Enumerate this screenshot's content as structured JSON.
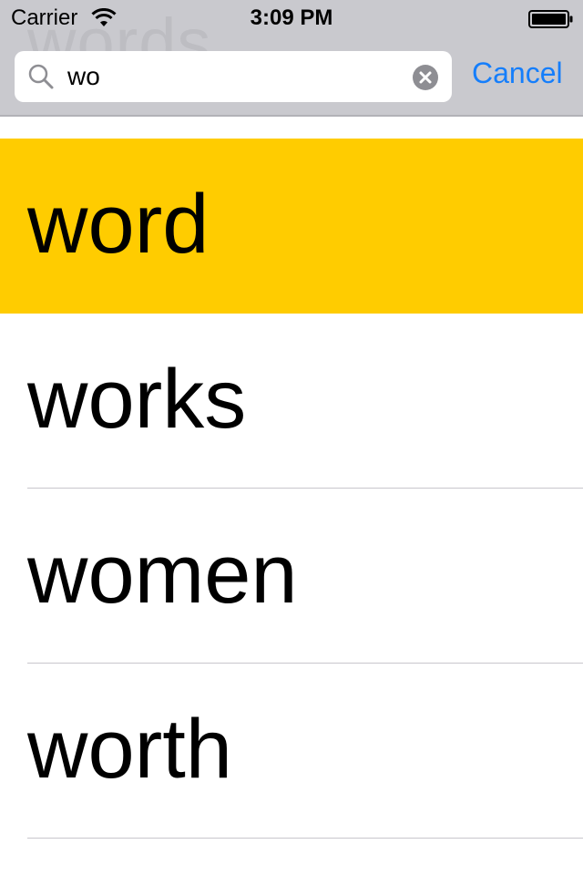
{
  "status_bar": {
    "carrier": "Carrier",
    "time": "3:09 PM",
    "wifi_icon": "wifi-icon",
    "battery_icon": "battery-icon"
  },
  "header": {
    "ghost_title": "words"
  },
  "search": {
    "value": "wo",
    "search_icon": "search-icon",
    "clear_icon": "clear-icon",
    "cancel_label": "Cancel"
  },
  "colors": {
    "accent": "#157efb",
    "selected_row": "#ffcc00",
    "header_bg": "#c9c9ce"
  },
  "results": [
    {
      "label": "word",
      "selected": true
    },
    {
      "label": "works",
      "selected": false
    },
    {
      "label": "women",
      "selected": false
    },
    {
      "label": "worth",
      "selected": false
    }
  ]
}
